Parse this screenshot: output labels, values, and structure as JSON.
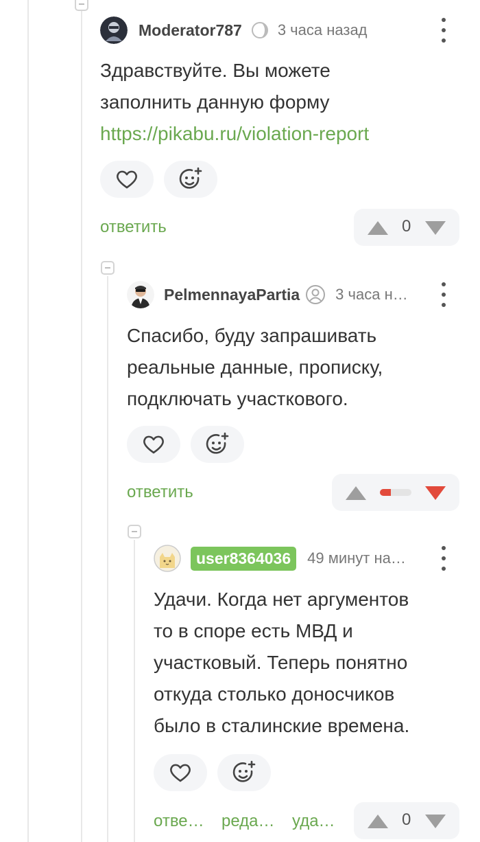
{
  "comments": [
    {
      "user": "Moderator787",
      "time": "3 часа назад",
      "text_lines": [
        "Здравствуйте. Вы можете",
        "заполнить данную форму"
      ],
      "link": "https://pikabu.ru/violation-report",
      "actions": [
        "ответить"
      ],
      "rating": "0",
      "avatar_icon": "moderator-avatar-icon",
      "status_icon": "moon-icon"
    },
    {
      "user": "PelmennayaPartia",
      "time": "3 часа н…",
      "text_lines": [
        "Спасибо, буду запрашивать",
        "реальные данные, прописку,",
        "подключать участкового."
      ],
      "actions": [
        "ответить"
      ],
      "rating_ratio": 0.35,
      "avatar_icon": "suit-man-avatar-icon",
      "status_icon": "user-circle-icon"
    },
    {
      "user": "user8364036",
      "time": "49 минут на…",
      "text_lines": [
        "Удачи. Когда нет аргументов",
        "то в споре есть МВД и",
        "участковый. Теперь понятно",
        "откуда столько доносчиков",
        "было в сталинские времена."
      ],
      "actions": [
        "отве…",
        "реда…",
        "уда…"
      ],
      "rating": "0",
      "avatar_icon": "cat-avatar-icon"
    }
  ],
  "colors": {
    "accent_green": "#6aa84f",
    "badge_green": "#7cc55c",
    "downvote_red": "#e24a3b",
    "arrow_gray": "#9e9e9e"
  }
}
